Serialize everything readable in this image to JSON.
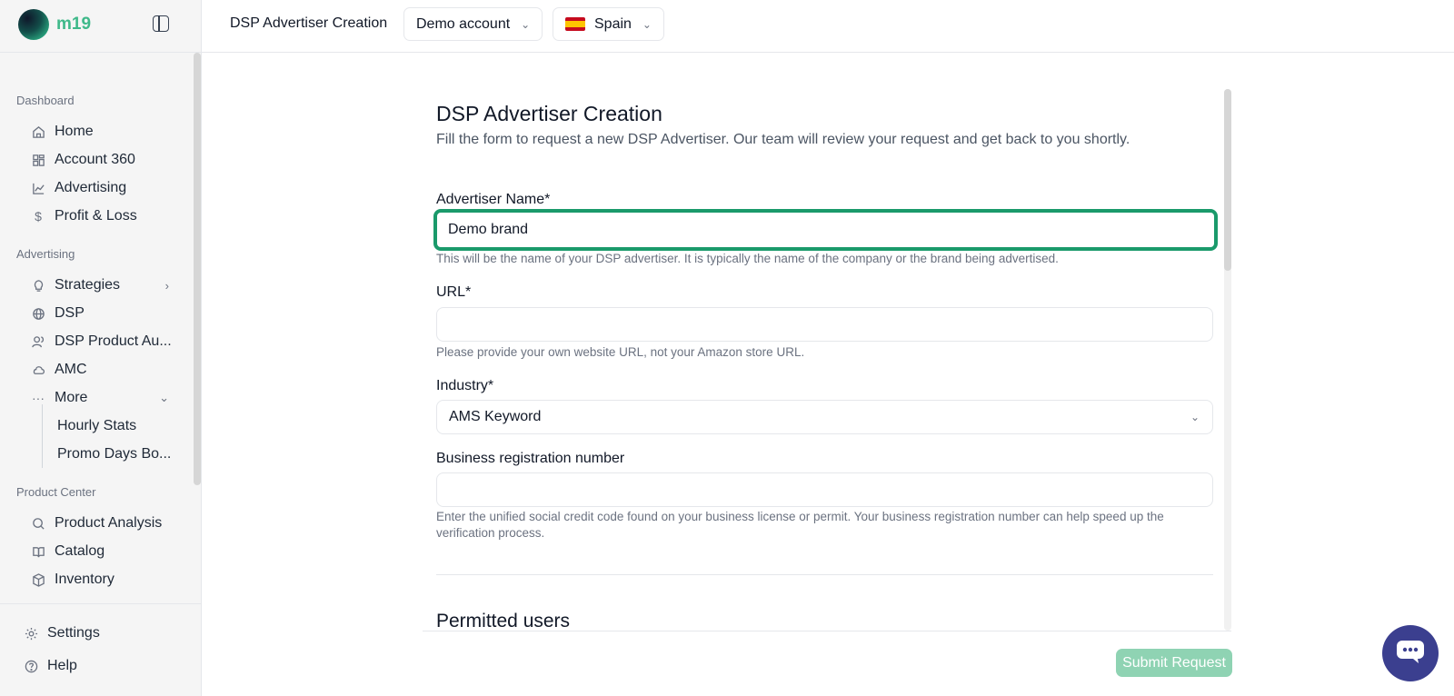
{
  "app": {
    "logo_text": "m19"
  },
  "sidebar": {
    "sections": {
      "dashboard": "Dashboard",
      "advertising": "Advertising",
      "product_center": "Product Center"
    },
    "items": [
      {
        "label": "Home",
        "icon": "home-icon"
      },
      {
        "label": "Account 360",
        "icon": "grid-icon"
      },
      {
        "label": "Advertising",
        "icon": "chart-line-icon"
      },
      {
        "label": "Profit & Loss",
        "icon": "dollar-icon"
      },
      {
        "label": "Strategies",
        "icon": "lightbulb-icon"
      },
      {
        "label": "DSP",
        "icon": "globe-icon"
      },
      {
        "label": "DSP Product Au...",
        "icon": "users-icon"
      },
      {
        "label": "AMC",
        "icon": "cloud-icon"
      },
      {
        "label": "More",
        "icon": "ellipsis-icon"
      },
      {
        "label": "Product Analysis",
        "icon": "search-icon"
      },
      {
        "label": "Catalog",
        "icon": "book-icon"
      },
      {
        "label": "Inventory",
        "icon": "box-icon"
      }
    ],
    "sub_items": [
      "Hourly Stats",
      "Promo Days Bo..."
    ],
    "footer": {
      "settings": "Settings",
      "help": "Help"
    }
  },
  "topbar": {
    "title": "DSP Advertiser Creation",
    "account": "Demo account",
    "country": "Spain"
  },
  "form": {
    "title": "DSP Advertiser Creation",
    "subtitle": "Fill the form to request a new DSP Advertiser. Our team will review your request and get back to you shortly.",
    "advertiser_name": {
      "label": "Advertiser Name*",
      "value": "Demo brand",
      "help": "This will be the name of your DSP advertiser. It is typically the name of the company or the brand being advertised."
    },
    "url": {
      "label": "URL*",
      "value": "",
      "help": "Please provide your own website URL, not your Amazon store URL."
    },
    "industry": {
      "label": "Industry*",
      "value": "AMS Keyword"
    },
    "business_registration": {
      "label": "Business registration number",
      "value": "",
      "help": "Enter the unified social credit code found on your business license or permit. Your business registration number can help speed up the verification process."
    },
    "permitted_users_title": "Permitted users",
    "submit_label": "Submit Request"
  },
  "colors": {
    "accent": "#1a9a6b",
    "submit_disabled": "#8fd3b3",
    "chat_button": "#3b3f8f"
  }
}
